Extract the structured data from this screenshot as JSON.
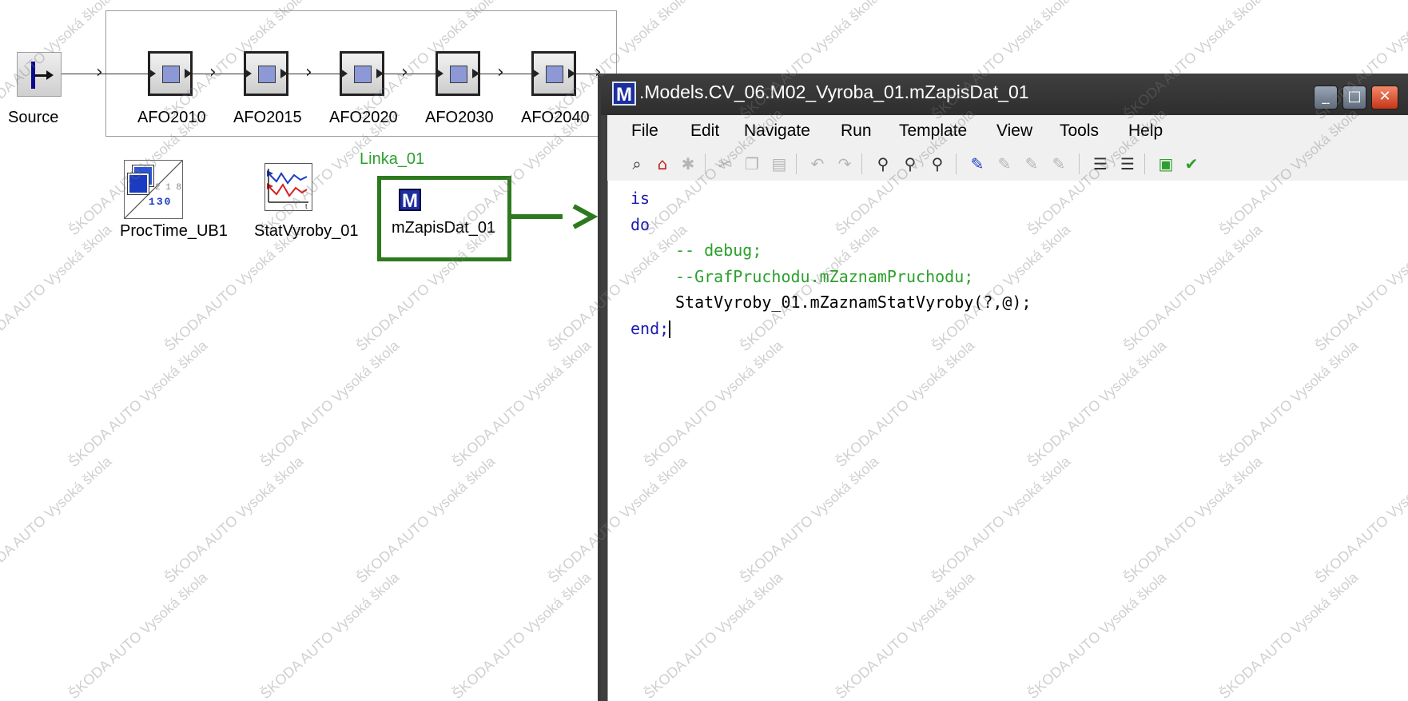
{
  "canvas": {
    "source_label": "Source",
    "stations": [
      "AFO2010",
      "AFO2015",
      "AFO2020",
      "AFO2030",
      "AFO2040"
    ],
    "frame_label": "Linka_01",
    "proctime_label": "ProcTime_UB1",
    "proctime_digits": [
      "1",
      "3",
      "0"
    ],
    "proctime_small": "2 1 8",
    "stat_label": "StatVyroby_01",
    "method_label": "mZapisDat_01",
    "method_icon_letter": "M",
    "highlight_color": "#2d7a1e"
  },
  "editor": {
    "title": ".Models.CV_06.M02_Vyroba_01.mZapisDat_01",
    "app_icon_letter": "M",
    "window_buttons": {
      "minimize": "_",
      "maximize": "□",
      "close": "✕"
    },
    "menu": [
      "File",
      "Edit",
      "Navigate",
      "Run",
      "Template",
      "View",
      "Tools",
      "Help"
    ],
    "toolbar_icons": [
      "binoculars-icon",
      "home-icon",
      "bug-icon",
      "cut-icon",
      "copy-icon",
      "paste-icon",
      "undo-icon",
      "redo-icon",
      "find-icon",
      "find-next-icon",
      "replace-icon",
      "breakpoint-icon",
      "clear-breakpoint-icon",
      "toggle-breakpoint-icon",
      "remove-breakpoints-icon",
      "sort-icon",
      "format-icon",
      "window-icon",
      "check-icon"
    ],
    "code_lines": [
      {
        "indent": 0,
        "kind": "keyword",
        "text": "is"
      },
      {
        "indent": 0,
        "kind": "keyword",
        "text": "do"
      },
      {
        "indent": 1,
        "kind": "comment",
        "text": "-- debug;"
      },
      {
        "indent": 1,
        "kind": "comment",
        "text": "--GrafPruchodu.mZaznamPruchodu;"
      },
      {
        "indent": 1,
        "kind": "text",
        "text": "StatVyroby_01.mZaznamStatVyroby(?,@);"
      },
      {
        "indent": 0,
        "kind": "keyword",
        "text": "end;"
      }
    ]
  },
  "watermark": "ŠKODA AUTO Vysoká škola"
}
